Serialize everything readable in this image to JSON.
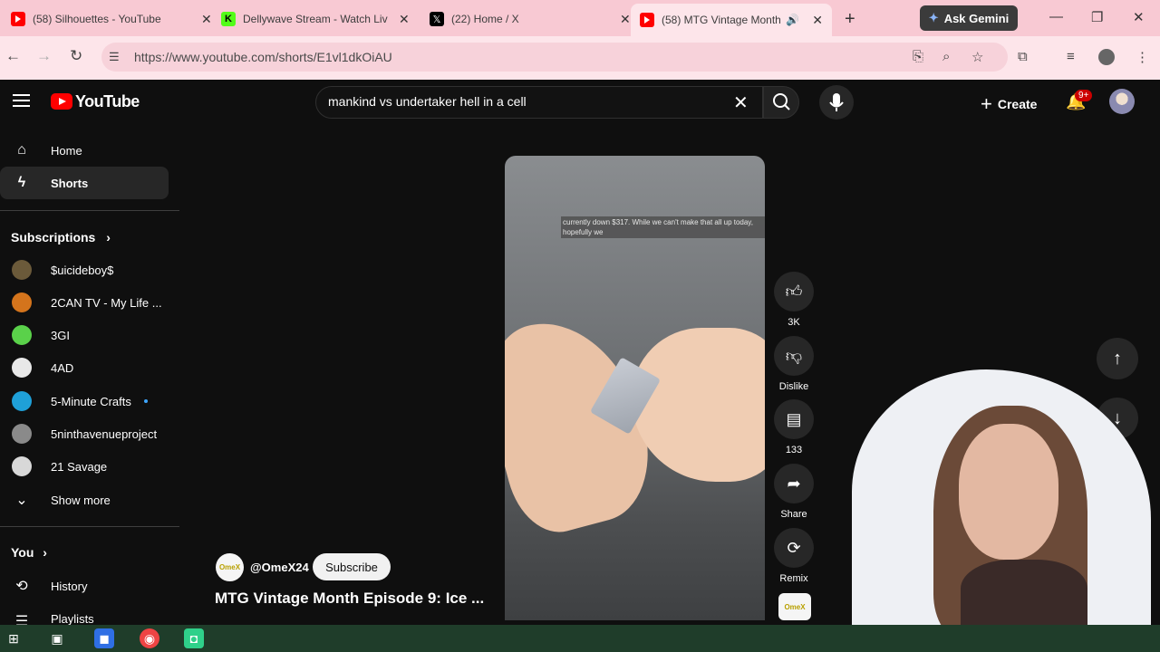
{
  "browser": {
    "tabs": [
      {
        "title": "(58) Silhouettes - YouTube",
        "favicon": "youtube-icon"
      },
      {
        "title": "Dellywave Stream - Watch Liv",
        "favicon": "kick-icon"
      },
      {
        "title": "(22) Home / X",
        "favicon": "x-icon"
      },
      {
        "title": "(58) MTG Vintage Month",
        "favicon": "youtube-icon"
      }
    ],
    "ask_gemini": "Ask Gemini",
    "url": "https://www.youtube.com/shorts/E1vl1dkOiAU",
    "new_tab": "+"
  },
  "youtube": {
    "logo_text": "YouTube",
    "search_query": "mankind vs undertaker hell in a cell",
    "create_label": "Create",
    "notification_count": "9+"
  },
  "sidebar": {
    "main": [
      {
        "label": "Home",
        "icon": "home-icon"
      },
      {
        "label": "Shorts",
        "icon": "shorts-icon"
      }
    ],
    "subscriptions_header": "Subscriptions",
    "subscriptions": [
      {
        "label": "$uicideboy$",
        "color": "#6b5a3a"
      },
      {
        "label": "2CAN TV - My Life ...",
        "color": "#d4741c"
      },
      {
        "label": "3GI",
        "color": "#5ad14a"
      },
      {
        "label": "4AD",
        "color": "#e8e8e8"
      },
      {
        "label": "5-Minute Crafts",
        "color": "#1fa0d8"
      },
      {
        "label": "5ninthavenueproject",
        "color": "#8a8a8a"
      },
      {
        "label": "21 Savage",
        "color": "#d8d8d8"
      }
    ],
    "show_more": "Show more",
    "you_header": "You",
    "you_items": [
      {
        "label": "History",
        "icon": "history-icon"
      },
      {
        "label": "Playlists",
        "icon": "playlists-icon"
      }
    ]
  },
  "short": {
    "caption": "currently down $317. While we can't make that all up today, hopefully we",
    "channel_handle": "@OmeX24",
    "channel_avatar_text": "OmeX",
    "subscribe_label": "Subscribe",
    "title": "MTG Vintage Month Episode 9: Ice ...",
    "actions": {
      "like_count": "3K",
      "dislike_label": "Dislike",
      "comments_count": "133",
      "share_label": "Share",
      "remix_label": "Remix"
    }
  }
}
